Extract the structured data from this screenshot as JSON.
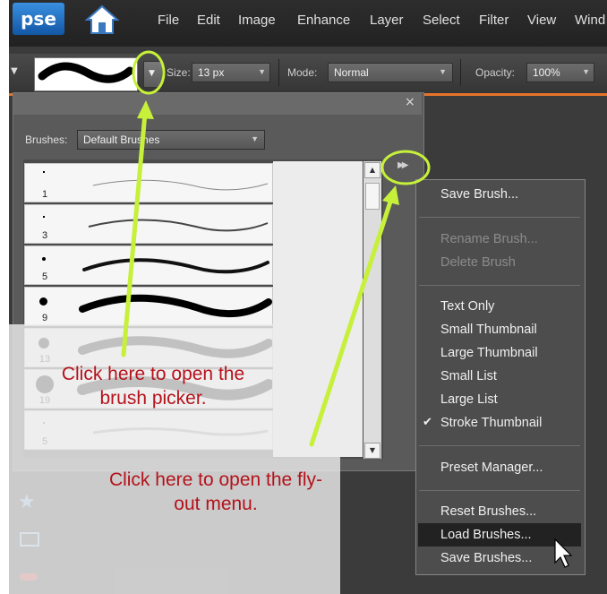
{
  "app": {
    "logo": "pse",
    "menu": [
      "File",
      "Edit",
      "Image",
      "Enhance",
      "Layer",
      "Select",
      "Filter",
      "View",
      "Wind"
    ]
  },
  "options": {
    "size_label": "Size:",
    "size_value": "13 px",
    "mode_label": "Mode:",
    "mode_value": "Normal",
    "opacity_label": "Opacity:",
    "opacity_value": "100%"
  },
  "brush_panel": {
    "brushes_label": "Brushes:",
    "brushes_value": "Default Brushes",
    "sizes": [
      "1",
      "3",
      "5",
      "9",
      "13",
      "19",
      "5"
    ]
  },
  "flyout": {
    "groups": [
      [
        {
          "label": "Save Brush...",
          "enabled": true
        }
      ],
      [
        {
          "label": "Rename Brush...",
          "enabled": false
        },
        {
          "label": "Delete Brush",
          "enabled": false
        }
      ],
      [
        {
          "label": "Text Only",
          "enabled": true
        },
        {
          "label": "Small Thumbnail",
          "enabled": true
        },
        {
          "label": "Large Thumbnail",
          "enabled": true
        },
        {
          "label": "Small List",
          "enabled": true
        },
        {
          "label": "Large List",
          "enabled": true
        },
        {
          "label": "Stroke Thumbnail",
          "enabled": true,
          "checked": true
        }
      ],
      [
        {
          "label": "Preset Manager...",
          "enabled": true
        }
      ],
      [
        {
          "label": "Reset Brushes...",
          "enabled": true
        },
        {
          "label": "Load Brushes...",
          "enabled": true,
          "highlighted": true
        },
        {
          "label": "Save Brushes...",
          "enabled": true
        }
      ]
    ]
  },
  "callouts": {
    "picker": "Click here to open the brush picker.",
    "flyout": "Click here to open the fly-out menu."
  },
  "colors": {
    "highlight_ring": "#c6f03a",
    "callout_text": "#b5121b",
    "accent_bar": "#e7742a"
  }
}
